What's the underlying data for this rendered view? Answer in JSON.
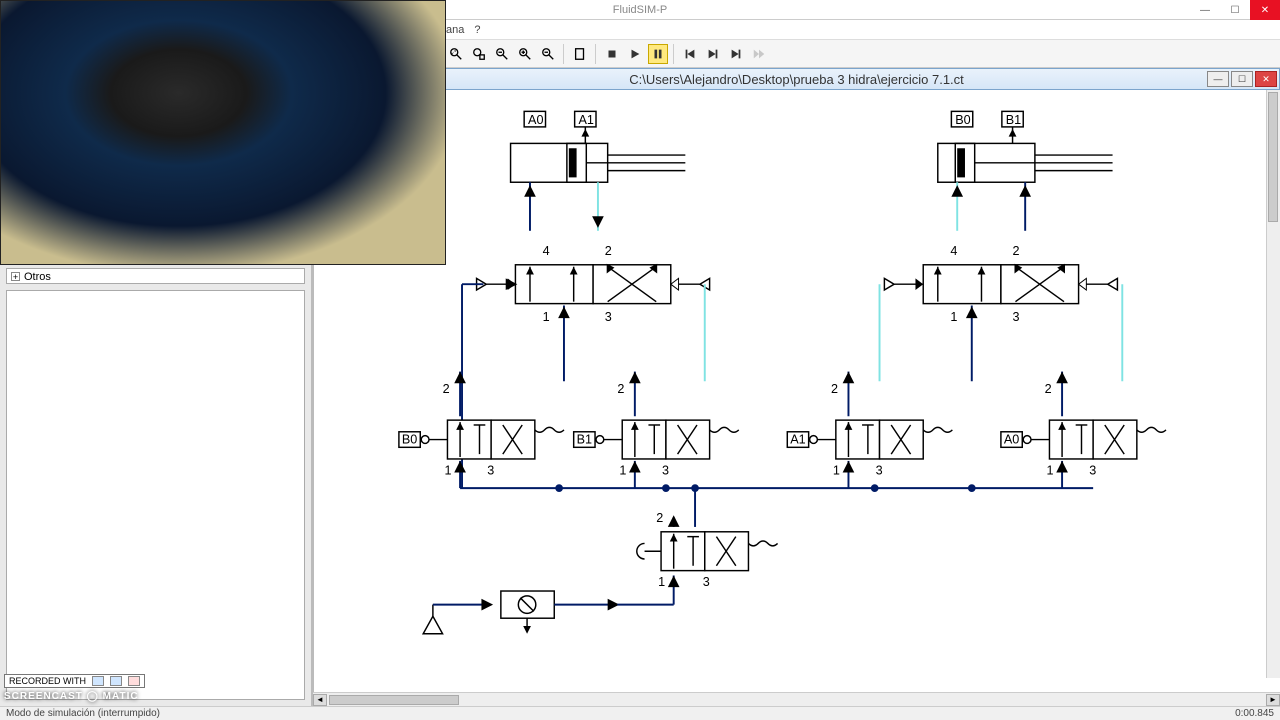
{
  "app": {
    "title": "FluidSIM-P"
  },
  "menu": {
    "item1": "ana",
    "item2": "?"
  },
  "doc": {
    "path": "C:\\Users\\Alejandro\\Desktop\\prueba 3 hidra\\ejercicio 7.1.ct"
  },
  "tree": {
    "plus": "+",
    "otros": "Otros"
  },
  "status": {
    "mode": "Modo de simulación (interrumpido)",
    "time": "0:00.845"
  },
  "rec": {
    "text": "RECORDED WITH",
    "brand": "SCREENCAST  ◯  MATIC"
  },
  "labels": {
    "A0": "A0",
    "A1": "A1",
    "B0": "B0",
    "B1": "B1",
    "p1": "1",
    "p2": "2",
    "p3": "3",
    "p4": "4",
    "btnB0": "B0",
    "btnB1": "B1",
    "btnA1": "A1",
    "btnA0": "A0"
  }
}
